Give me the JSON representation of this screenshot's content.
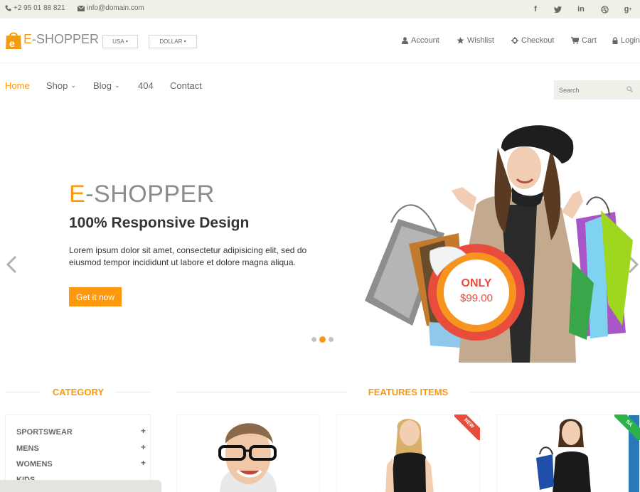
{
  "topbar": {
    "phone": "+2 95 01 88 821",
    "email": "info@domain.com",
    "social": [
      "facebook-icon",
      "twitter-icon",
      "linkedin-icon",
      "dribbble-icon",
      "google-plus-icon"
    ]
  },
  "header": {
    "logo_e": "E",
    "logo_rest": "-SHOPPER",
    "country_label": "USA",
    "currency_label": "DOLLAR",
    "account": "Account",
    "wishlist": "Wishlist",
    "checkout": "Checkout",
    "cart": "Cart",
    "login": "Login"
  },
  "nav": {
    "home": "Home",
    "shop": "Shop",
    "blog": "Blog",
    "page404": "404",
    "contact": "Contact",
    "search_placeholder": "Search"
  },
  "slider": {
    "brand_e": "E",
    "brand_rest": "-SHOPPER",
    "title": "100% Responsive Design",
    "description": "Lorem ipsum dolor sit amet, consectetur adipisicing elit, sed do eiusmod tempor incididunt ut labore et dolore magna aliqua.",
    "button": "Get it now",
    "badge_top": "ONLY",
    "badge_price": "$99.00",
    "active_slide": 2,
    "slide_count": 3
  },
  "sections": {
    "category_title": "CATEGORY",
    "features_title": "FEATURES ITEMS"
  },
  "categories": [
    "SPORTSWEAR",
    "MENS",
    "WOMENS",
    "KIDS"
  ],
  "ribbons": {
    "new": "NEW",
    "sale": "SA"
  },
  "colors": {
    "accent": "#fe980f",
    "topbar": "#f0f0e9",
    "text": "#696763",
    "dark": "#363432",
    "badge_red": "#e84c3d"
  }
}
